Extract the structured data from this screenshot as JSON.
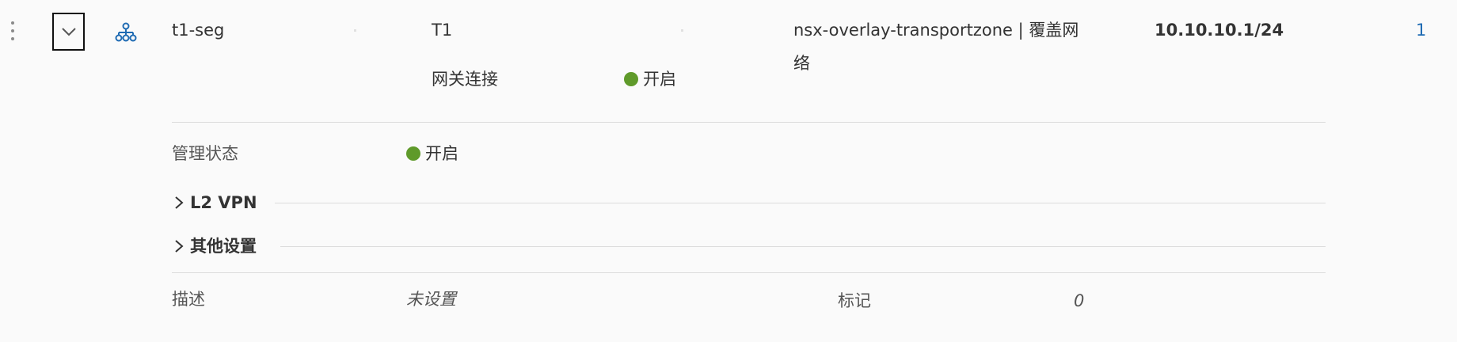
{
  "row": {
    "name": "t1-seg",
    "gateway": "T1",
    "transport_zone": "nsx-overlay-transportzone | 覆盖网",
    "transport_zone_wrap": "络",
    "subnet": "10.10.10.1/24",
    "count": "1",
    "gateway_connection_label": "网关连接",
    "gateway_connection_value": "开启"
  },
  "details": {
    "admin_state_label": "管理状态",
    "admin_state_value": "开启",
    "l2vpn_label": "L2 VPN",
    "other_settings_label": "其他设置",
    "description_label": "描述",
    "description_value": "未设置",
    "tags_label": "标记",
    "tags_value": "0"
  },
  "icons": {
    "kebab": "more-vertical-icon",
    "expand": "chevron-down-icon",
    "segment": "network-segment-icon",
    "status_on": "status-dot-green",
    "collapse": "chevron-right-icon"
  },
  "colors": {
    "status_on": "#5f9a2a",
    "link": "#1f6bb3",
    "background": "#fafafa"
  }
}
